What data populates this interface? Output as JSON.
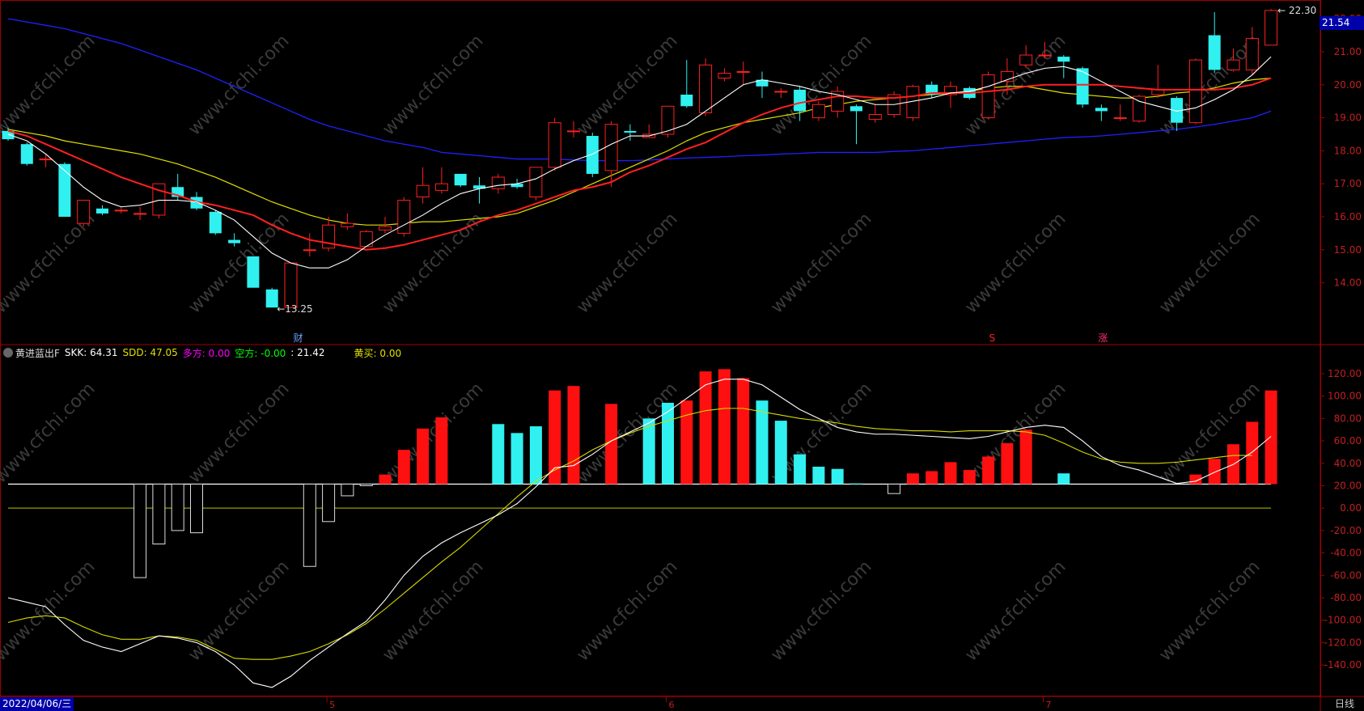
{
  "indicator_header": {
    "icon": "chevron-down-circle-icon",
    "name": "黄进蓝出F",
    "skk": "SKK: 64.31",
    "sdd": "SDD: 47.05",
    "long": "多方: 0.00",
    "short": "空方: -0.00",
    "value": ": 21.42",
    "buy": "黄买: 0.00"
  },
  "price_tag": "21.54",
  "high_label": "22.30",
  "low_label": "13.25",
  "markers": {
    "cai": "财",
    "s": "S",
    "zhang": "涨"
  },
  "date_tag": "2022/04/06/三",
  "period": "日线",
  "x_months": [
    "5",
    "6",
    "7"
  ],
  "watermark": "www.cfchi.com",
  "colors": {
    "up": "#ff2020",
    "down": "#30f0f0",
    "ma5": "#ffffff",
    "ma10": "#ff2020",
    "ma20": "#e0e000",
    "ma60": "#2020ff"
  },
  "chart_data": [
    {
      "type": "candlestick",
      "ylim": [
        13.0,
        22.3
      ],
      "yticks": [
        "22.00",
        "21.00",
        "20.00",
        "19.00",
        "18.00",
        "17.00",
        "16.00",
        "15.00",
        "14.00"
      ],
      "candles": [
        {
          "o": 18.6,
          "c": 18.35,
          "h": 18.7,
          "l": 18.3
        },
        {
          "o": 18.2,
          "c": 17.6,
          "h": 18.25,
          "l": 17.55
        },
        {
          "o": 17.75,
          "c": 17.75,
          "h": 17.9,
          "l": 17.5
        },
        {
          "o": 17.6,
          "c": 16.0,
          "h": 17.65,
          "l": 16.0
        },
        {
          "o": 15.8,
          "c": 16.5,
          "h": 16.5,
          "l": 15.7
        },
        {
          "o": 16.25,
          "c": 16.1,
          "h": 16.35,
          "l": 16.05
        },
        {
          "o": 16.2,
          "c": 16.2,
          "h": 16.3,
          "l": 16.1
        },
        {
          "o": 16.1,
          "c": 16.1,
          "h": 16.3,
          "l": 15.9
        },
        {
          "o": 16.05,
          "c": 17.0,
          "h": 17.0,
          "l": 15.95
        },
        {
          "o": 16.9,
          "c": 16.6,
          "h": 17.3,
          "l": 16.5
        },
        {
          "o": 16.6,
          "c": 16.25,
          "h": 16.75,
          "l": 16.2
        },
        {
          "o": 16.15,
          "c": 15.5,
          "h": 16.2,
          "l": 15.45
        },
        {
          "o": 15.3,
          "c": 15.2,
          "h": 15.5,
          "l": 15.1
        },
        {
          "o": 14.8,
          "c": 13.85,
          "h": 14.8,
          "l": 13.85
        },
        {
          "o": 13.8,
          "c": 13.25,
          "h": 13.85,
          "l": 13.25
        },
        {
          "o": 13.25,
          "c": 14.6,
          "h": 14.6,
          "l": 13.25
        },
        {
          "o": 15.0,
          "c": 15.0,
          "h": 15.5,
          "l": 14.8
        },
        {
          "o": 15.05,
          "c": 15.75,
          "h": 16.0,
          "l": 14.95
        },
        {
          "o": 15.7,
          "c": 15.8,
          "h": 16.1,
          "l": 15.6
        },
        {
          "o": 15.1,
          "c": 15.55,
          "h": 15.6,
          "l": 15.1
        },
        {
          "o": 15.6,
          "c": 15.7,
          "h": 16.0,
          "l": 15.5
        },
        {
          "o": 15.5,
          "c": 16.5,
          "h": 16.6,
          "l": 15.4
        },
        {
          "o": 16.6,
          "c": 16.95,
          "h": 17.5,
          "l": 16.4
        },
        {
          "o": 16.8,
          "c": 17.0,
          "h": 17.5,
          "l": 16.7
        },
        {
          "o": 17.3,
          "c": 16.95,
          "h": 17.3,
          "l": 16.9
        },
        {
          "o": 16.95,
          "c": 16.85,
          "h": 17.2,
          "l": 16.4
        },
        {
          "o": 16.85,
          "c": 17.2,
          "h": 17.3,
          "l": 16.7
        },
        {
          "o": 17.0,
          "c": 16.9,
          "h": 17.15,
          "l": 16.85
        },
        {
          "o": 16.6,
          "c": 17.5,
          "h": 17.5,
          "l": 16.5
        },
        {
          "o": 17.5,
          "c": 18.85,
          "h": 19.0,
          "l": 17.4
        },
        {
          "o": 18.6,
          "c": 18.6,
          "h": 18.9,
          "l": 18.4
        },
        {
          "o": 18.45,
          "c": 17.3,
          "h": 18.55,
          "l": 17.2
        },
        {
          "o": 17.4,
          "c": 18.8,
          "h": 18.9,
          "l": 16.9
        },
        {
          "o": 18.6,
          "c": 18.55,
          "h": 18.8,
          "l": 18.3
        },
        {
          "o": 18.4,
          "c": 18.5,
          "h": 18.8,
          "l": 18.4
        },
        {
          "o": 18.5,
          "c": 19.35,
          "h": 19.35,
          "l": 18.4
        },
        {
          "o": 19.7,
          "c": 19.35,
          "h": 20.75,
          "l": 19.3
        },
        {
          "o": 19.15,
          "c": 20.6,
          "h": 20.8,
          "l": 19.05
        },
        {
          "o": 20.2,
          "c": 20.35,
          "h": 20.5,
          "l": 20.1
        },
        {
          "o": 20.4,
          "c": 20.4,
          "h": 20.7,
          "l": 20.0
        },
        {
          "o": 20.15,
          "c": 19.95,
          "h": 20.4,
          "l": 19.6
        },
        {
          "o": 19.8,
          "c": 19.8,
          "h": 19.9,
          "l": 19.6
        },
        {
          "o": 19.85,
          "c": 19.2,
          "h": 19.95,
          "l": 18.9
        },
        {
          "o": 19.0,
          "c": 19.4,
          "h": 19.5,
          "l": 18.9
        },
        {
          "o": 19.2,
          "c": 19.8,
          "h": 19.95,
          "l": 19.0
        },
        {
          "o": 19.35,
          "c": 19.2,
          "h": 19.4,
          "l": 18.2
        },
        {
          "o": 18.95,
          "c": 19.1,
          "h": 19.4,
          "l": 18.85
        },
        {
          "o": 19.1,
          "c": 19.7,
          "h": 19.8,
          "l": 19.0
        },
        {
          "o": 19.0,
          "c": 19.95,
          "h": 20.0,
          "l": 18.9
        },
        {
          "o": 20.0,
          "c": 19.7,
          "h": 20.1,
          "l": 19.6
        },
        {
          "o": 19.7,
          "c": 19.95,
          "h": 20.1,
          "l": 19.3
        },
        {
          "o": 19.9,
          "c": 19.6,
          "h": 19.95,
          "l": 19.55
        },
        {
          "o": 19.0,
          "c": 20.3,
          "h": 20.4,
          "l": 18.95
        },
        {
          "o": 20.1,
          "c": 20.4,
          "h": 20.8,
          "l": 19.7
        },
        {
          "o": 20.6,
          "c": 20.9,
          "h": 21.2,
          "l": 20.5
        },
        {
          "o": 20.9,
          "c": 20.9,
          "h": 21.3,
          "l": 20.8
        },
        {
          "o": 20.85,
          "c": 20.7,
          "h": 20.9,
          "l": 20.2
        },
        {
          "o": 20.5,
          "c": 19.4,
          "h": 20.55,
          "l": 19.3
        },
        {
          "o": 19.3,
          "c": 19.2,
          "h": 19.4,
          "l": 18.9
        },
        {
          "o": 19.0,
          "c": 19.0,
          "h": 19.4,
          "l": 18.9
        },
        {
          "o": 18.9,
          "c": 19.65,
          "h": 19.7,
          "l": 18.85
        },
        {
          "o": 19.7,
          "c": 19.85,
          "h": 20.6,
          "l": 19.6
        },
        {
          "o": 19.6,
          "c": 18.85,
          "h": 19.65,
          "l": 18.6
        },
        {
          "o": 18.85,
          "c": 20.75,
          "h": 20.8,
          "l": 18.8
        },
        {
          "o": 21.5,
          "c": 20.45,
          "h": 22.2,
          "l": 20.35
        },
        {
          "o": 20.45,
          "c": 20.75,
          "h": 21.1,
          "l": 20.4
        },
        {
          "o": 20.45,
          "c": 21.4,
          "h": 21.75,
          "l": 20.3
        },
        {
          "o": 21.2,
          "c": 22.25,
          "h": 22.3,
          "l": 21.2
        }
      ],
      "ma5": [
        18.5,
        18.3,
        17.9,
        17.4,
        16.9,
        16.5,
        16.3,
        16.35,
        16.5,
        16.5,
        16.45,
        16.2,
        15.9,
        15.4,
        14.9,
        14.6,
        14.45,
        14.45,
        14.7,
        15.1,
        15.45,
        15.75,
        16.05,
        16.4,
        16.7,
        16.85,
        16.95,
        17.0,
        17.15,
        17.45,
        17.7,
        17.9,
        18.2,
        18.45,
        18.45,
        18.6,
        18.8,
        19.2,
        19.6,
        20.0,
        20.15,
        20.05,
        19.95,
        19.8,
        19.7,
        19.55,
        19.4,
        19.4,
        19.5,
        19.6,
        19.75,
        19.8,
        19.95,
        20.15,
        20.35,
        20.5,
        20.55,
        20.4,
        20.1,
        19.8,
        19.5,
        19.35,
        19.2,
        19.3,
        19.55,
        19.85,
        20.3,
        20.85
      ],
      "ma10": [
        18.6,
        18.45,
        18.2,
        17.95,
        17.7,
        17.45,
        17.2,
        17.0,
        16.8,
        16.65,
        16.45,
        16.35,
        16.2,
        16.05,
        15.75,
        15.5,
        15.3,
        15.2,
        15.1,
        15.0,
        15.05,
        15.15,
        15.3,
        15.45,
        15.6,
        15.85,
        16.05,
        16.2,
        16.4,
        16.6,
        16.8,
        16.9,
        17.05,
        17.35,
        17.55,
        17.8,
        18.05,
        18.25,
        18.55,
        18.85,
        19.1,
        19.3,
        19.45,
        19.55,
        19.65,
        19.65,
        19.6,
        19.6,
        19.65,
        19.75,
        19.75,
        19.75,
        19.8,
        19.85,
        19.95,
        20.0,
        20.0,
        20.0,
        20.0,
        19.95,
        19.9,
        19.85,
        19.85,
        19.85,
        19.85,
        19.9,
        20.0,
        20.2
      ],
      "ma20": [
        18.65,
        18.55,
        18.45,
        18.3,
        18.2,
        18.1,
        18.0,
        17.9,
        17.75,
        17.6,
        17.4,
        17.2,
        16.95,
        16.7,
        16.45,
        16.25,
        16.05,
        15.9,
        15.8,
        15.75,
        15.75,
        15.8,
        15.85,
        15.85,
        15.9,
        15.95,
        16.0,
        16.1,
        16.3,
        16.5,
        16.75,
        17.0,
        17.25,
        17.5,
        17.75,
        18.0,
        18.3,
        18.55,
        18.7,
        18.85,
        18.95,
        19.05,
        19.15,
        19.3,
        19.4,
        19.5,
        19.55,
        19.6,
        19.65,
        19.7,
        19.75,
        19.8,
        19.9,
        19.95,
        19.95,
        19.85,
        19.75,
        19.7,
        19.65,
        19.6,
        19.6,
        19.65,
        19.75,
        19.8,
        19.9,
        20.05,
        20.15,
        20.2
      ],
      "ma60": [
        22.0,
        21.9,
        21.8,
        21.7,
        21.55,
        21.4,
        21.25,
        21.05,
        20.85,
        20.65,
        20.45,
        20.2,
        19.95,
        19.7,
        19.45,
        19.2,
        18.95,
        18.75,
        18.6,
        18.45,
        18.3,
        18.2,
        18.1,
        17.95,
        17.9,
        17.85,
        17.8,
        17.75,
        17.75,
        17.75,
        17.72,
        17.7,
        17.7,
        17.7,
        17.72,
        17.75,
        17.78,
        17.8,
        17.82,
        17.85,
        17.87,
        17.9,
        17.92,
        17.95,
        17.95,
        17.95,
        17.95,
        17.98,
        18.0,
        18.05,
        18.1,
        18.15,
        18.2,
        18.25,
        18.3,
        18.35,
        18.4,
        18.42,
        18.45,
        18.5,
        18.55,
        18.6,
        18.65,
        18.72,
        18.8,
        18.9,
        19.0,
        19.2
      ]
    },
    {
      "type": "bar",
      "name": "黄进蓝出F",
      "ylim": [
        -160,
        130
      ],
      "yticks": [
        "120.00",
        "100.00",
        "80.00",
        "60.00",
        "40.00",
        "20.00",
        "0.00",
        "-20.00",
        "-40.00",
        "-60.00",
        "-80.00",
        "-100.00",
        "-120.00",
        "-140.00"
      ],
      "baseline": 21.42,
      "bars": [
        {
          "i": 7,
          "v": -62,
          "c": "hollow"
        },
        {
          "i": 8,
          "v": -32,
          "c": "hollow"
        },
        {
          "i": 9,
          "v": -20,
          "c": "hollow"
        },
        {
          "i": 10,
          "v": -22,
          "c": "hollow"
        },
        {
          "i": 16,
          "v": -52,
          "c": "hollow"
        },
        {
          "i": 17,
          "v": -12,
          "c": "hollow"
        },
        {
          "i": 18,
          "v": 11,
          "c": "hollow"
        },
        {
          "i": 19,
          "v": 20,
          "c": "hollow"
        },
        {
          "i": 20,
          "v": 30,
          "c": "red"
        },
        {
          "i": 21,
          "v": 52,
          "c": "red"
        },
        {
          "i": 22,
          "v": 71,
          "c": "red"
        },
        {
          "i": 23,
          "v": 81,
          "c": "red"
        },
        {
          "i": 26,
          "v": 75,
          "c": "cyan"
        },
        {
          "i": 27,
          "v": 67,
          "c": "cyan"
        },
        {
          "i": 28,
          "v": 73,
          "c": "cyan"
        },
        {
          "i": 29,
          "v": 105,
          "c": "red"
        },
        {
          "i": 30,
          "v": 109,
          "c": "red"
        },
        {
          "i": 32,
          "v": 93,
          "c": "red"
        },
        {
          "i": 34,
          "v": 80,
          "c": "cyan"
        },
        {
          "i": 35,
          "v": 94,
          "c": "cyan"
        },
        {
          "i": 36,
          "v": 96,
          "c": "red"
        },
        {
          "i": 37,
          "v": 122,
          "c": "red"
        },
        {
          "i": 38,
          "v": 124,
          "c": "red"
        },
        {
          "i": 39,
          "v": 116,
          "c": "red"
        },
        {
          "i": 40,
          "v": 96,
          "c": "cyan"
        },
        {
          "i": 41,
          "v": 78,
          "c": "cyan"
        },
        {
          "i": 42,
          "v": 48,
          "c": "cyan"
        },
        {
          "i": 43,
          "v": 37,
          "c": "cyan"
        },
        {
          "i": 44,
          "v": 35,
          "c": "cyan"
        },
        {
          "i": 45,
          "v": 22,
          "c": "cyan"
        },
        {
          "i": 47,
          "v": 13,
          "c": "hollow"
        },
        {
          "i": 48,
          "v": 31,
          "c": "red"
        },
        {
          "i": 49,
          "v": 33,
          "c": "red"
        },
        {
          "i": 50,
          "v": 41,
          "c": "red"
        },
        {
          "i": 51,
          "v": 34,
          "c": "red"
        },
        {
          "i": 52,
          "v": 46,
          "c": "red"
        },
        {
          "i": 53,
          "v": 58,
          "c": "red"
        },
        {
          "i": 54,
          "v": 70,
          "c": "red"
        },
        {
          "i": 56,
          "v": 31,
          "c": "cyan"
        },
        {
          "i": 63,
          "v": 30,
          "c": "red"
        },
        {
          "i": 64,
          "v": 44,
          "c": "red"
        },
        {
          "i": 65,
          "v": 57,
          "c": "red"
        },
        {
          "i": 66,
          "v": 77,
          "c": "red"
        },
        {
          "i": 67,
          "v": 105,
          "c": "red"
        }
      ],
      "skk": [
        -80,
        -84,
        -88,
        -104,
        -118,
        -124,
        -128,
        -121,
        -114,
        -116,
        -120,
        -128,
        -140,
        -156,
        -160,
        -150,
        -136,
        -124,
        -112,
        -101,
        -82,
        -60,
        -43,
        -31,
        -22,
        -14,
        -6,
        4,
        19,
        36,
        38,
        48,
        60,
        68,
        76,
        86,
        98,
        110,
        115,
        115,
        110,
        99,
        88,
        80,
        72,
        68,
        66,
        66,
        65,
        64,
        63,
        62,
        64,
        68,
        72,
        74,
        72,
        60,
        46,
        38,
        34,
        28,
        22,
        24,
        32,
        39,
        50,
        64
      ],
      "sdd": [
        -102,
        -98,
        -96,
        -98,
        -106,
        -113,
        -117,
        -117,
        -114,
        -115,
        -118,
        -126,
        -134,
        -135,
        -135,
        -132,
        -128,
        -121,
        -113,
        -103,
        -90,
        -76,
        -62,
        -48,
        -35,
        -20,
        -5,
        10,
        24,
        34,
        42,
        52,
        60,
        67,
        73,
        78,
        83,
        87,
        89,
        89,
        86,
        83,
        80,
        78,
        76,
        73,
        71,
        70,
        69,
        69,
        68,
        69,
        69,
        69,
        68,
        65,
        58,
        50,
        44,
        41,
        40,
        40,
        41,
        43,
        45,
        47,
        47
      ]
    }
  ]
}
